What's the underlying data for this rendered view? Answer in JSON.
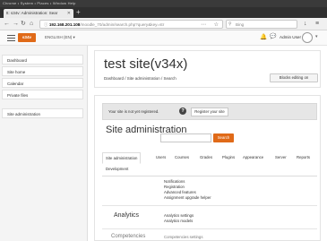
{
  "browser": {
    "titlebar_text": "Chrome • System • Places • Window Help",
    "tab_title": "tt: s34v: Administration: Sear",
    "new_tab_label": "+",
    "nav_icons": [
      "←",
      "→",
      "↻",
      "⌂"
    ],
    "url_host": "192.168.201.108",
    "url_path": "/moodle_70/admin/search.php?query&key=str",
    "search_placeholder": "Bing",
    "toolbar_icons": [
      "↓",
      "≡"
    ]
  },
  "moodle_navbar": {
    "brand_label": "s34v",
    "language": "ENGLISH (EN) ▾",
    "user_name": "Admin User",
    "caret": "▾"
  },
  "drawer": {
    "items": [
      {
        "label": "Dashboard"
      },
      {
        "label": "Site home"
      },
      {
        "label": "Calendar"
      },
      {
        "label": "Private files"
      },
      {
        "label": "Site administration"
      }
    ]
  },
  "header": {
    "title": "test site(v34x)",
    "breadcrumb": "Dashboard / Site administration / Search",
    "blocks_button": "Blocks editing on"
  },
  "main": {
    "alert_text": "Your site is not yet registered.",
    "alert_help": "?",
    "register_button": "Register your site",
    "section_title": "Site administration",
    "search_button": "Search",
    "search_value": "",
    "tabs": [
      {
        "label": "Site administration"
      },
      {
        "label": "Users"
      },
      {
        "label": "Courses"
      },
      {
        "label": "Grades"
      },
      {
        "label": "Plugins"
      },
      {
        "label": "Appearance"
      },
      {
        "label": "Server"
      },
      {
        "label": "Reports"
      },
      {
        "label": "Development"
      }
    ],
    "top_links": [
      "Notifications",
      "Registration",
      "Advanced features",
      "Assignment upgrade helper"
    ],
    "analytics_heading": "Analytics",
    "analytics_links": [
      "Analytics settings",
      "Analytics models"
    ],
    "partial_heading": "Competencies",
    "partial_link": "Competencies settings"
  }
}
